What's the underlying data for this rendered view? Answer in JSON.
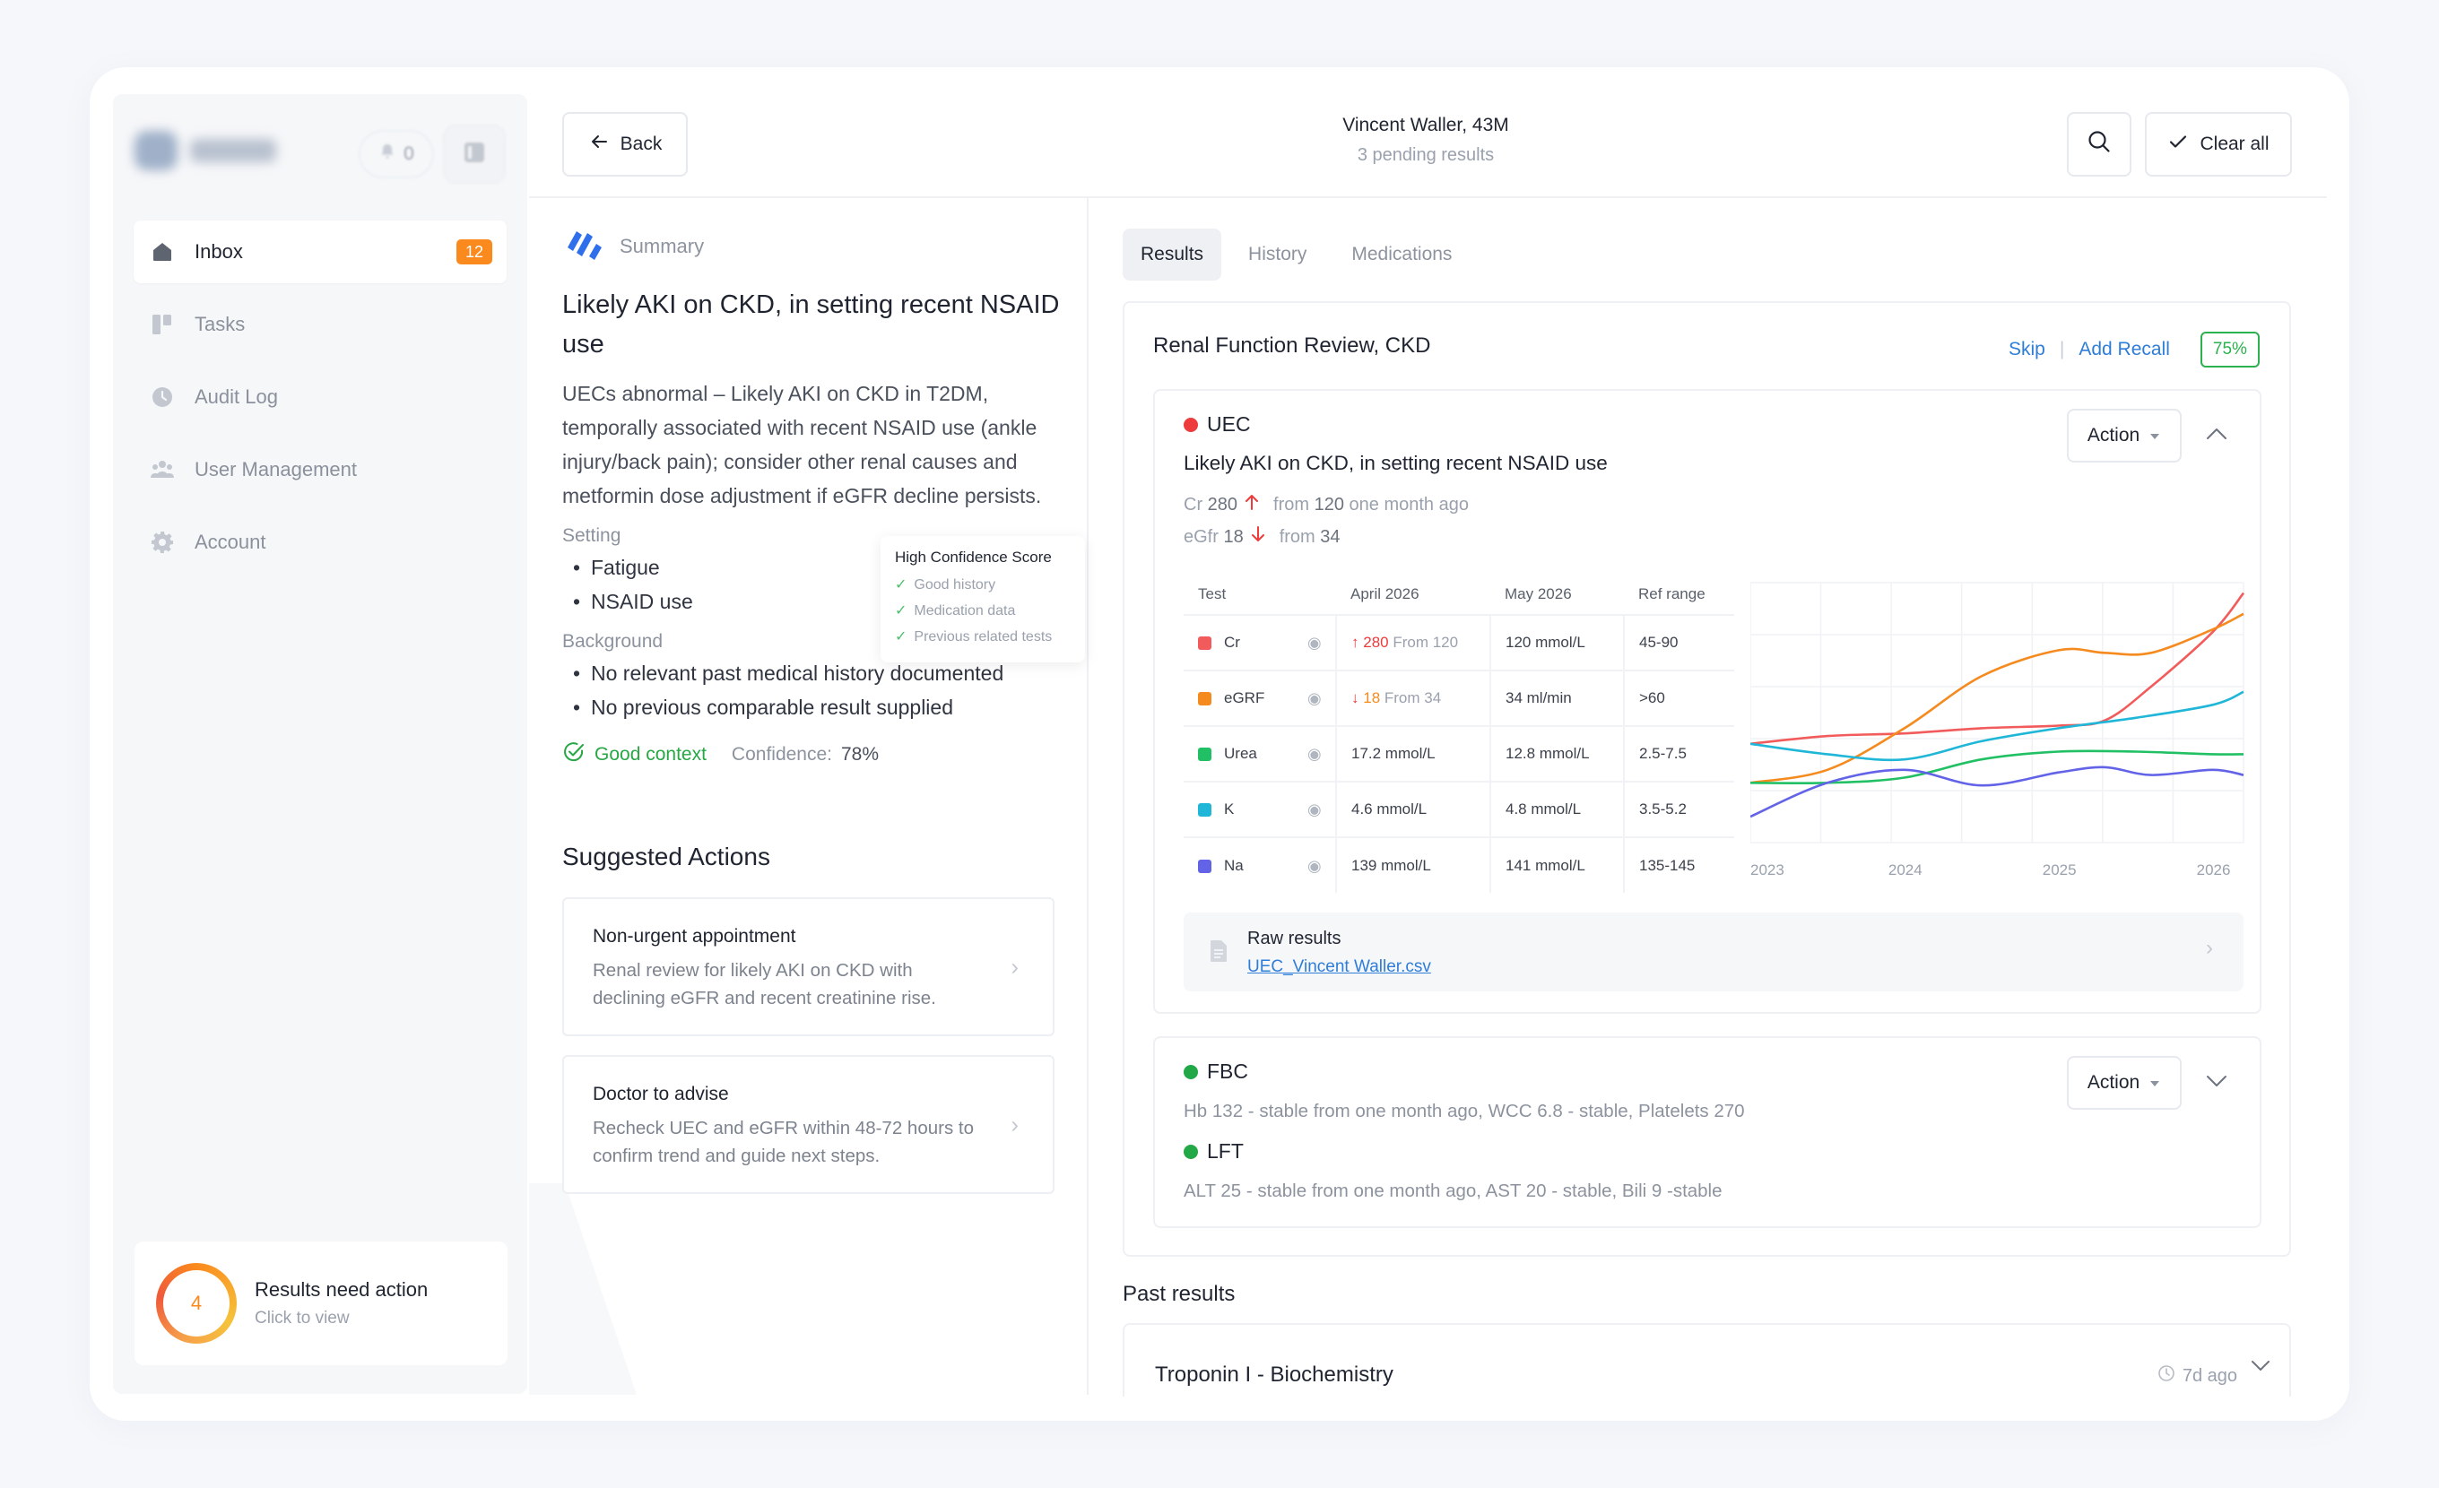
{
  "sidebar": {
    "notifications_count": "0",
    "nav": [
      {
        "label": "Inbox",
        "badge": "12"
      },
      {
        "label": "Tasks"
      },
      {
        "label": "Audit Log"
      },
      {
        "label": "User Management"
      },
      {
        "label": "Account"
      }
    ],
    "action_card": {
      "count": "4",
      "title": "Results need action",
      "subtitle": "Click to view"
    }
  },
  "header": {
    "back_label": "Back",
    "patient_name": "Vincent Waller, 43M",
    "pending": "3 pending results",
    "clear_label": "Clear all"
  },
  "summary": {
    "heading": "Summary",
    "title": "Likely AKI on CKD, in setting recent NSAID use",
    "description": "UECs abnormal – Likely AKI on CKD in T2DM, temporally associated with recent NSAID use (ankle injury/back pain); consider other renal causes and metformin dose adjustment if eGFR decline persists.",
    "setting_label": "Setting",
    "setting_items": [
      "Fatigue",
      "NSAID use"
    ],
    "background_label": "Background",
    "background_items": [
      "No relevant past medical history documented",
      "No previous comparable result supplied"
    ],
    "context_label": "Good context",
    "confidence_label": "Confidence:",
    "confidence_value": "78%",
    "tooltip": {
      "title": "High Confidence Score",
      "items": [
        "Good history",
        "Medication data",
        "Previous related tests"
      ]
    }
  },
  "suggested": {
    "title": "Suggested Actions",
    "cards": [
      {
        "title": "Non-urgent appointment",
        "desc": "Renal review for likely AKI on CKD with declining eGFR and recent creatinine rise."
      },
      {
        "title": "Doctor to advise",
        "desc": "Recheck UEC and eGFR within 48-72 hours to confirm trend and guide next steps."
      }
    ]
  },
  "tabs": [
    "Results",
    "History",
    "Medications"
  ],
  "panel": {
    "title": "Renal Function Review, CKD",
    "skip": "Skip",
    "add_recall": "Add Recall",
    "progress": "75%",
    "colors": {
      "red": "#ee3b3b",
      "green": "#22a846",
      "blue": "#2e7dd8",
      "orange": "#f58a1f"
    }
  },
  "uec": {
    "name": "UEC",
    "summary": "Likely AKI on CKD, in setting recent NSAID use",
    "metrics": [
      {
        "name": "Cr",
        "value": "280",
        "from_label": "from",
        "from_value": "120",
        "suffix": "one month ago"
      },
      {
        "name": "eGfr",
        "value": "18",
        "from_label": "from",
        "from_value": "34",
        "suffix": ""
      }
    ],
    "action_label": "Action",
    "table": {
      "headers": [
        "Test",
        "April 2026",
        "May 2026",
        "Ref range"
      ],
      "rows": [
        {
          "test": "Cr",
          "color": "#f25b5b",
          "april": "280",
          "april_from": "From 120",
          "may": "120 mmol/L",
          "ref": "45-90",
          "trend": "up"
        },
        {
          "test": "eGRF",
          "color": "#f58a1f",
          "april": "18",
          "april_from": "From 34",
          "may": "34 ml/min",
          "ref": ">60",
          "trend": "down"
        },
        {
          "test": "Urea",
          "color": "#22c064",
          "april": "17.2  mmol/L",
          "april_from": "",
          "may": "12.8 mmol/L",
          "ref": "2.5-7.5",
          "trend": ""
        },
        {
          "test": "K",
          "color": "#1fb6d8",
          "april": "4.6 mmol/L",
          "april_from": "",
          "may": "4.8 mmol/L",
          "ref": "3.5-5.2",
          "trend": ""
        },
        {
          "test": "Na",
          "color": "#6363e8",
          "april": "139 mmol/L",
          "april_from": "",
          "may": "141 mmol/L",
          "ref": "135-145",
          "trend": ""
        }
      ]
    },
    "raw": {
      "title": "Raw results",
      "file": "UEC_Vincent Waller.csv"
    }
  },
  "chart_data": {
    "type": "line",
    "x": [
      2023,
      2024,
      2025,
      2026
    ],
    "x_tick_labels": [
      "2023",
      "2024",
      "2025",
      "2026"
    ],
    "ylim": [
      0,
      100
    ],
    "grid": true,
    "series": [
      {
        "name": "Cr",
        "color": "#f25b5b",
        "values": [
          [
            2023.0,
            38
          ],
          [
            2023.5,
            41
          ],
          [
            2024.0,
            42
          ],
          [
            2024.5,
            44
          ],
          [
            2025.0,
            45
          ],
          [
            2025.3,
            47
          ],
          [
            2025.6,
            60
          ],
          [
            2026.0,
            81
          ],
          [
            2026.2,
            96
          ]
        ]
      },
      {
        "name": "eGRF",
        "color": "#f58a1f",
        "values": [
          [
            2023.0,
            23
          ],
          [
            2023.5,
            28
          ],
          [
            2024.0,
            44
          ],
          [
            2024.5,
            64
          ],
          [
            2025.0,
            74
          ],
          [
            2025.3,
            73
          ],
          [
            2025.6,
            73
          ],
          [
            2026.0,
            82
          ],
          [
            2026.2,
            88
          ]
        ]
      },
      {
        "name": "Urea",
        "color": "#22c064",
        "values": [
          [
            2023.0,
            23
          ],
          [
            2023.5,
            23
          ],
          [
            2024.0,
            25
          ],
          [
            2024.5,
            32
          ],
          [
            2025.0,
            35
          ],
          [
            2025.5,
            35
          ],
          [
            2026.0,
            34
          ],
          [
            2026.2,
            34
          ]
        ]
      },
      {
        "name": "K",
        "color": "#1fb6d8",
        "values": [
          [
            2023.0,
            38
          ],
          [
            2023.5,
            34
          ],
          [
            2024.0,
            32
          ],
          [
            2024.5,
            39
          ],
          [
            2025.0,
            44
          ],
          [
            2025.5,
            48
          ],
          [
            2026.0,
            53
          ],
          [
            2026.2,
            58
          ]
        ]
      },
      {
        "name": "Na",
        "color": "#6363e8",
        "values": [
          [
            2023.0,
            10
          ],
          [
            2023.5,
            23
          ],
          [
            2024.0,
            28
          ],
          [
            2024.5,
            22
          ],
          [
            2025.0,
            27
          ],
          [
            2025.3,
            29
          ],
          [
            2025.6,
            26
          ],
          [
            2026.0,
            28
          ],
          [
            2026.2,
            26
          ]
        ]
      }
    ]
  },
  "fbc": {
    "name": "FBC",
    "desc": "Hb 132 - stable from one month ago, WCC 6.8 - stable, Platelets 270",
    "lft_name": "LFT",
    "lft_desc": "ALT 25 - stable from one month ago, AST 20 - stable, Bili 9 -stable",
    "action_label": "Action"
  },
  "past": {
    "title": "Past results",
    "item": "Troponin I - Biochemistry",
    "ago": "7d ago"
  }
}
